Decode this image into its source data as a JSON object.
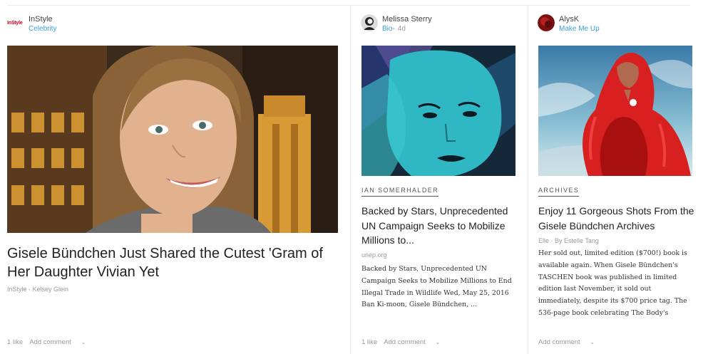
{
  "cards": [
    {
      "source": {
        "name": "InStyle",
        "logo_text": "InStyle",
        "sub": "Celebrity"
      },
      "title": "Gisele Bündchen Just Shared the Cutest 'Gram of Her Daughter Vivian Yet",
      "meta": "InStyle · Kelsey Glein",
      "actions": {
        "likes": "1 like",
        "comment": "Add comment"
      }
    },
    {
      "source": {
        "name": "Melissa Sterry",
        "sub": "Bio-",
        "age": "4d"
      },
      "topic": "IAN SOMERHALDER",
      "title": "Backed by Stars, Unprecedented UN Campaign Seeks to Mobilize Millions to...",
      "meta": "unep.org",
      "excerpt": "Backed by Stars, Unprecedented UN Campaign Seeks to Mobilize Millions to End Illegal Trade in Wildlife Wed, May 25, 2016 Ban Ki-moon, Gisele Bündchen, ...",
      "actions": {
        "likes": "1 like",
        "comment": "Add comment"
      }
    },
    {
      "source": {
        "name": "AlysK",
        "sub": "Make Me Up"
      },
      "topic": "ARCHIVES",
      "title": "Enjoy 11 Gorgeous Shots From the Gisele Bündchen Archives",
      "meta": "Elle · By Estelle Tang",
      "excerpt": "Her sold out, limited edition ($700!) book is available again. When Gisele Bündchen's TASCHEN book was published in limited edition last November, it sold out immediately, despite its $700 price tag. The 536-page book celebrating The Body's",
      "actions": {
        "comment": "Add comment"
      }
    }
  ],
  "colors": {
    "link": "#3b9ed6",
    "brand_red": "#d0021b",
    "muted": "#9a9a9a"
  },
  "icons": {
    "chevron": "chevron-down-icon"
  }
}
